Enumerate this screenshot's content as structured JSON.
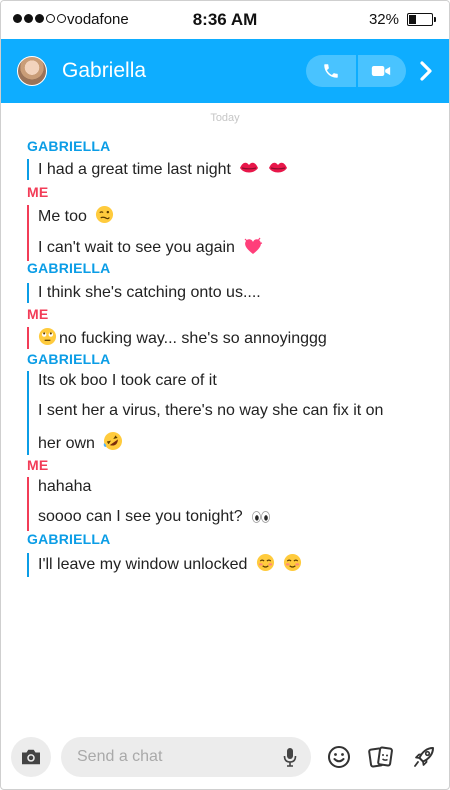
{
  "status_bar": {
    "carrier": "vodafone",
    "time": "8:36 AM",
    "battery_percent": "32%",
    "battery_level": 0.32,
    "signal_bars_filled": 3,
    "signal_bars_total": 5
  },
  "header": {
    "contact_name": "Gabriella",
    "accent_color": "#0eadff",
    "icons": [
      "avatar",
      "phone-icon",
      "video-camera-icon",
      "chevron-right-icon"
    ]
  },
  "chat": {
    "day_label": "Today",
    "blocks": [
      {
        "sender": "GABRIELLA",
        "messages": [
          {
            "text": "I had a great time last night",
            "emoji": "kiss-mark-icon x2"
          }
        ]
      },
      {
        "sender": "ME",
        "messages": [
          {
            "text": "Me too",
            "emoji": "woozy-face-icon"
          },
          {
            "text": "I can't wait to see you again",
            "emoji": "heart-icon"
          }
        ]
      },
      {
        "sender": "GABRIELLA",
        "messages": [
          {
            "text": "I think she's catching onto us...."
          }
        ]
      },
      {
        "sender": "ME",
        "messages": [
          {
            "text": "no fucking way... she's so annoyinggg",
            "emoji": "eye-roll-icon"
          }
        ]
      },
      {
        "sender": "GABRIELLA",
        "messages": [
          {
            "text": "Its ok boo I took care of it"
          },
          {
            "text": "I sent her a virus, there's no way she can fix it on"
          },
          {
            "text": "her own",
            "emoji": "rofl-face-icon"
          }
        ]
      },
      {
        "sender": "ME",
        "messages": [
          {
            "text": "hahaha"
          },
          {
            "text": "soooo can I see you tonight?",
            "emoji": "eyes-icon"
          }
        ]
      },
      {
        "sender": "GABRIELLA",
        "messages": [
          {
            "text": "I'll leave my window unlocked",
            "emoji": "blush-face-icon x2"
          }
        ]
      }
    ],
    "colors": {
      "gabriella": "#0b9de6",
      "me": "#f23c57"
    }
  },
  "composer": {
    "placeholder": "Send a chat",
    "icons": [
      "camera-icon",
      "mic-icon",
      "smiley-icon",
      "sticker-cards-icon",
      "rocket-icon"
    ]
  }
}
